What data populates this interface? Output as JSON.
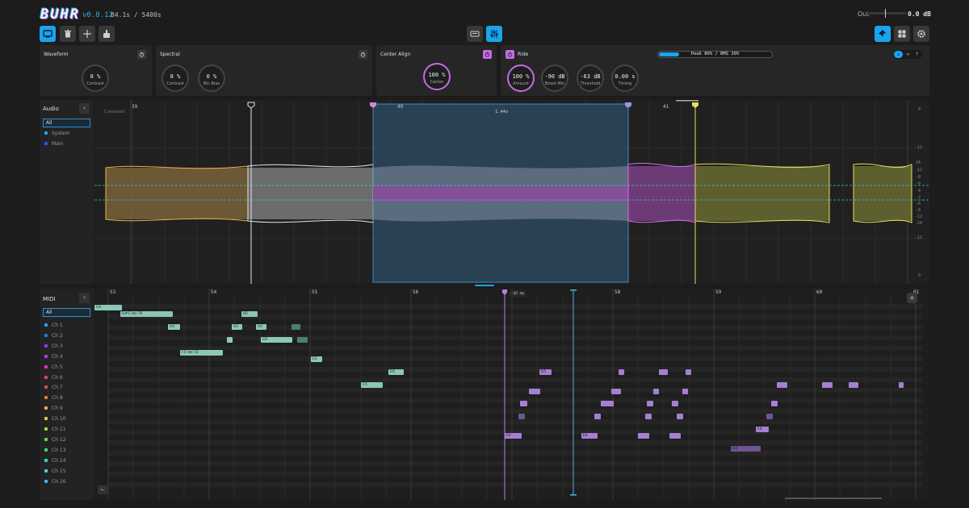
{
  "app": {
    "logo": "BUHR",
    "version": "v0.8.12",
    "time": "84.1s / 5400s",
    "output_label": "Out",
    "output_value": "0.0 dB"
  },
  "toolbar": {
    "left_buttons": [
      "monitor-icon",
      "trash-icon",
      "split-icon",
      "export-icon"
    ],
    "center_buttons": [
      "keyboard-icon",
      "sliders-icon"
    ],
    "right_buttons": [
      "pin-icon",
      "grid-icon",
      "gear-icon"
    ]
  },
  "panels": {
    "waveform": {
      "title": "Waveform",
      "knob_value": "0 %",
      "knob_label": "Contrast"
    },
    "spectral": {
      "title": "Spectral",
      "knobs": [
        {
          "value": "0 %",
          "label": "Contrast"
        },
        {
          "value": "0 %",
          "label": "Bin Bias"
        }
      ]
    },
    "center_align": {
      "title": "Center Align",
      "knob_value": "100 %",
      "knob_label": "Center"
    },
    "ride": {
      "title": "Ride",
      "meter_text": "Peak 80% / RMS 20%",
      "meter_level": 0.18,
      "knobs": [
        {
          "value": "100 %",
          "label": "Amount"
        },
        {
          "value": "-90 dB",
          "label": "Boost Min"
        },
        {
          "value": "-63 dB",
          "label": "Threshold"
        },
        {
          "value": "0.00 s",
          "label": "Timing"
        }
      ],
      "mode_buttons": [
        "down-arrow-icon",
        "infinity-icon",
        "up-arrow-icon"
      ]
    }
  },
  "audio": {
    "title": "Audio",
    "filter": "All",
    "items": [
      {
        "label": "System",
        "color": "#1aa4ef"
      },
      {
        "label": "Main",
        "color": "#2f54e8"
      }
    ],
    "lane_label": "Combined",
    "bars": [
      "39",
      "40",
      "41"
    ],
    "selection_length": "1.44s",
    "db_scale_top": [
      "0",
      "-12"
    ],
    "db_scale_mid": [
      "24",
      "-12",
      "-8",
      "-6",
      "-4",
      "-2",
      "-6",
      "-8",
      "-12",
      "-24"
    ],
    "db_scale_bottom": [
      "-12",
      "0"
    ]
  },
  "midi": {
    "title": "MIDI",
    "filter": "All",
    "channels": [
      {
        "label": "Ch 1",
        "color": "#1aa4ef"
      },
      {
        "label": "Ch 2",
        "color": "#3a6df0"
      },
      {
        "label": "Ch 3",
        "color": "#8a3df0"
      },
      {
        "label": "Ch 4",
        "color": "#b43ce0"
      },
      {
        "label": "Ch 5",
        "color": "#d83cc0"
      },
      {
        "label": "Ch 6",
        "color": "#e03c8a"
      },
      {
        "label": "Ch 7",
        "color": "#e05050"
      },
      {
        "label": "Ch 8",
        "color": "#e08040"
      },
      {
        "label": "Ch 9",
        "color": "#e0b040"
      },
      {
        "label": "Ch 10",
        "color": "#d8d040"
      },
      {
        "label": "Ch 11",
        "color": "#a8d840"
      },
      {
        "label": "Ch 12",
        "color": "#70d840"
      },
      {
        "label": "Ch 13",
        "color": "#40d870"
      },
      {
        "label": "Ch 14",
        "color": "#40d8a8"
      },
      {
        "label": "Ch 15",
        "color": "#40d8d8"
      },
      {
        "label": "Ch 16",
        "color": "#40b8e8"
      }
    ],
    "bars": [
      "53",
      "54",
      "55",
      "56",
      "57",
      "58",
      "59",
      "60",
      "61"
    ],
    "playhead_offset": "-42 ms",
    "notes": [
      {
        "label": "C6"
      },
      {
        "label": "D#5 Vel 76"
      },
      {
        "label": "B5"
      },
      {
        "label": "A5"
      },
      {
        "label": "A5"
      },
      {
        "label": "A5"
      },
      {
        "label": "G5"
      },
      {
        "label": "F5 Vel 72"
      },
      {
        "label": "E5"
      },
      {
        "label": "D5"
      },
      {
        "label": "C5"
      },
      {
        "label": "D5"
      },
      {
        "label": "E4"
      },
      {
        "label": "E4"
      },
      {
        "label": "F4"
      },
      {
        "label": "D4"
      }
    ]
  }
}
